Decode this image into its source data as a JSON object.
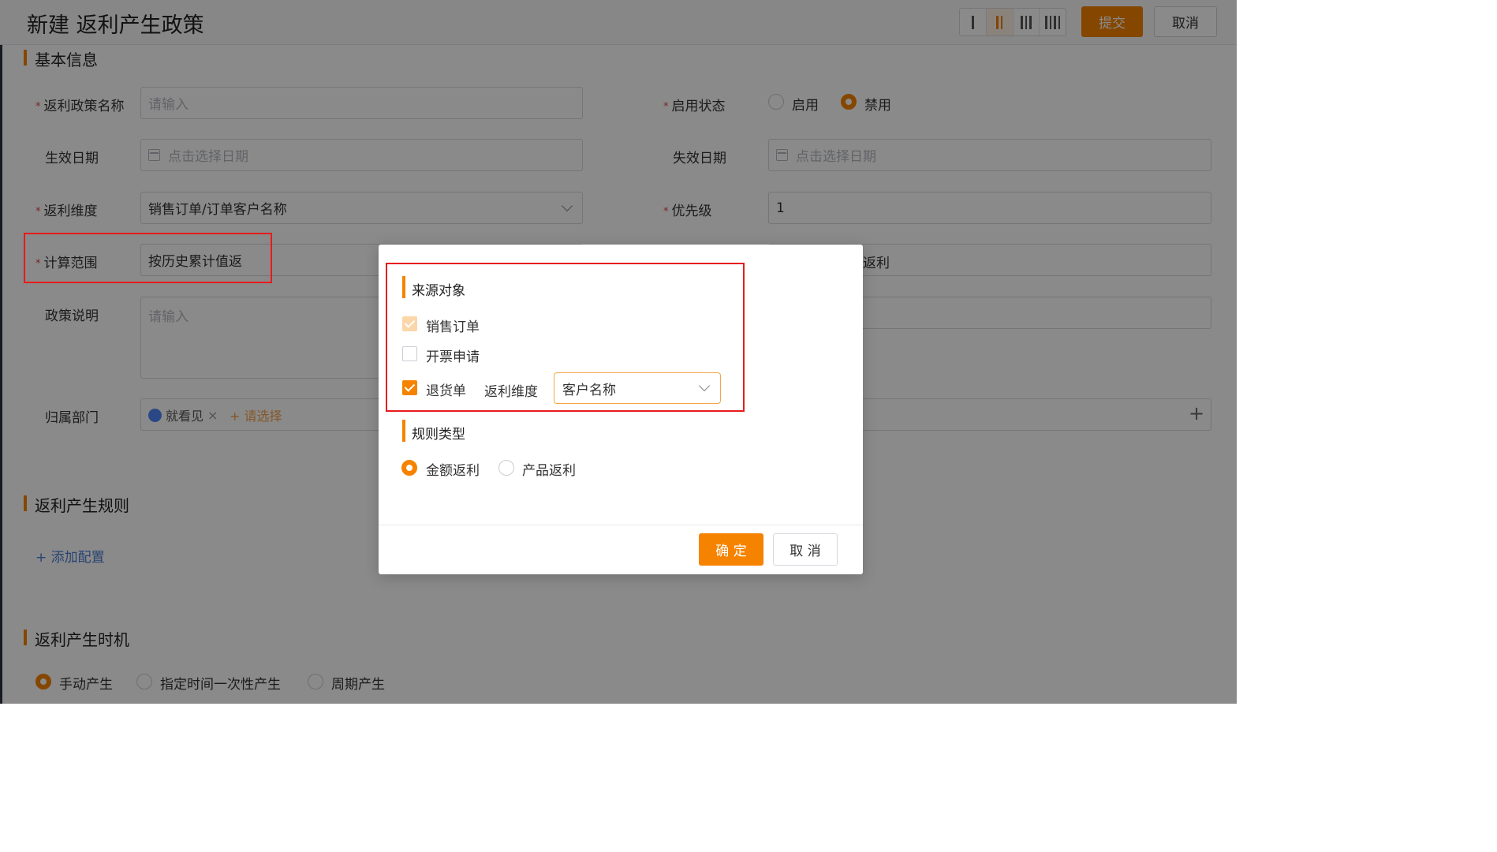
{
  "header": {
    "title": "新建 返利产生政策",
    "submit": "提交",
    "cancel": "取消"
  },
  "sections": {
    "basic": "基本信息",
    "rules": "返利产生规则",
    "timing": "返利产生时机"
  },
  "form": {
    "policy_name_label": "返利政策名称",
    "policy_name_placeholder": "请输入",
    "status_label": "启用状态",
    "status_enable": "启用",
    "status_disable": "禁用",
    "start_date_label": "生效日期",
    "end_date_label": "失效日期",
    "date_placeholder": "点击选择日期",
    "dimension_label": "返利维度",
    "dimension_value": "销售订单/订单客户名称",
    "priority_label": "优先级",
    "priority_value": "1",
    "scope_label": "计算范围",
    "scope_value": "按历史累计值返",
    "right_partial": "返利",
    "description_label": "政策说明",
    "description_placeholder": "请输入",
    "department_label": "归属部门",
    "department_tag": "就看见",
    "department_add": "+ 请选择"
  },
  "rules": {
    "add_config": "+ 添加配置"
  },
  "timing": {
    "manual": "手动产生",
    "once": "指定时间一次性产生",
    "periodic": "周期产生"
  },
  "modal": {
    "source_title": "来源对象",
    "sales_order": "销售订单",
    "invoice_request": "开票申请",
    "return_order": "退货单",
    "dimension_label": "返利维度",
    "dimension_value": "客户名称",
    "rule_type_title": "规则类型",
    "amount_rebate": "金额返利",
    "product_rebate": "产品返利",
    "ok": "确 定",
    "cancel": "取 消"
  },
  "colors": {
    "accent": "#f58300",
    "highlight": "#e61c1c"
  }
}
